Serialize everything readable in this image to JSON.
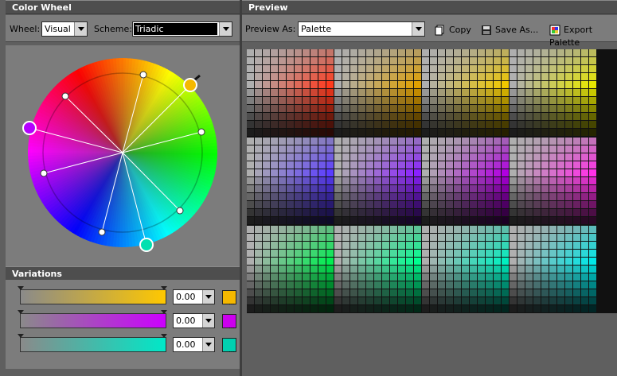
{
  "left_panel": {
    "title": "Color Wheel",
    "wheel_label": "Wheel:",
    "wheel_value": "Visual",
    "scheme_label": "Scheme:",
    "scheme_value": "Triadic"
  },
  "right_panel": {
    "title": "Preview",
    "preview_as_label": "Preview As:",
    "preview_as_value": "Palette",
    "copy_label": "Copy",
    "save_label": "Save As...",
    "export_label": "Export Palette"
  },
  "variations": {
    "title": "Variations",
    "rows": [
      {
        "value": "0.00",
        "swatch": "#f5b800",
        "end": "#ffc800"
      },
      {
        "value": "0.00",
        "swatch": "#cc00ee",
        "end": "#cc00ff"
      },
      {
        "value": "0.00",
        "swatch": "#00d0b0",
        "end": "#00e8c8"
      }
    ]
  },
  "colors": {
    "accent_orange": "#f5b800",
    "accent_purple": "#b400ff",
    "accent_teal": "#00e0b0"
  },
  "palette_hues": [
    [
      "#ff3a1e",
      "#e0a000",
      "#f0c800",
      "#e8e800"
    ],
    [
      "#5a3cff",
      "#8a20ff",
      "#b000e0",
      "#ff30e8"
    ],
    [
      "#00ee50",
      "#00ff90",
      "#00f0c0",
      "#00e8e8"
    ]
  ]
}
